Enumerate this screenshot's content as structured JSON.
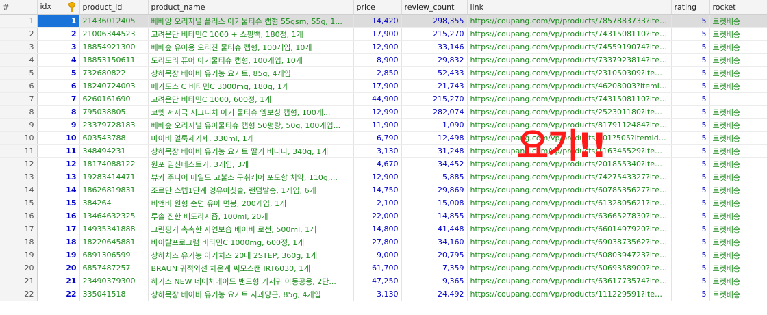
{
  "columns": [
    "#",
    "idx",
    "product_id",
    "product_name",
    "price",
    "review_count",
    "link",
    "rating",
    "rocket"
  ],
  "rows": [
    {
      "n": "1",
      "idx": "1",
      "pid": "21436012405",
      "name": "베베앙 오리지널 플러스 아기물티슈 캡형 55gsm, 55g, 1...",
      "price": "14,420",
      "reviews": "298,355",
      "link": "https://coupang.com/vp/products/7857883733?itemId=...",
      "rating": "5",
      "rocket": "로켓배송"
    },
    {
      "n": "2",
      "idx": "2",
      "pid": "21006344523",
      "name": "고려은단 비타민C 1000 + 쇼핑백, 180정, 1개",
      "price": "17,900",
      "reviews": "215,270",
      "link": "https://coupang.com/vp/products/7431508110?itemId=...",
      "rating": "5",
      "rocket": "로켓배송"
    },
    {
      "n": "3",
      "idx": "3",
      "pid": "18854921300",
      "name": "베베숲 유아용 오리진 물티슈 캡형, 100개입, 10개",
      "price": "12,900",
      "reviews": "33,146",
      "link": "https://coupang.com/vp/products/7455919074?itemId=...",
      "rating": "5",
      "rocket": "로켓배송"
    },
    {
      "n": "4",
      "idx": "4",
      "pid": "18853150611",
      "name": "도리도리 퓨어 아기물티슈 캡형, 100개입, 10개",
      "price": "8,900",
      "reviews": "29,832",
      "link": "https://coupang.com/vp/products/7337923814?itemId=...",
      "rating": "5",
      "rocket": "로켓배송"
    },
    {
      "n": "5",
      "idx": "5",
      "pid": "732680822",
      "name": "상하목장 베이비 유기농 요거트, 85g, 4개입",
      "price": "2,850",
      "reviews": "52,433",
      "link": "https://coupang.com/vp/products/231050309?itemId=7...",
      "rating": "5",
      "rocket": "로켓배송"
    },
    {
      "n": "6",
      "idx": "6",
      "pid": "18240724003",
      "name": "메가도스 C 비타민C 3000mg, 180g, 1개",
      "price": "17,900",
      "reviews": "21,743",
      "link": "https://coupang.com/vp/products/46208003?itemId=18...",
      "rating": "5",
      "rocket": "로켓배송"
    },
    {
      "n": "7",
      "idx": "7",
      "pid": "6260161690",
      "name": "고려은단 비타민C 1000, 600정, 1개",
      "price": "44,900",
      "reviews": "215,270",
      "link": "https://coupang.com/vp/products/7431508110?itemId=...",
      "rating": "5",
      "rocket": ""
    },
    {
      "n": "8",
      "idx": "8",
      "pid": "795038805",
      "name": "코멧 저자극 시그니처 아기 물티슈 엠보싱 캡형, 100개...",
      "price": "12,990",
      "reviews": "282,074",
      "link": "https://coupang.com/vp/products/252301180?itemId=7...",
      "rating": "5",
      "rocket": "로켓배송"
    },
    {
      "n": "9",
      "idx": "9",
      "pid": "23379728183",
      "name": "베베숲 오리지널 유아물티슈 캡형 50평량, 50g, 100개입...",
      "price": "11,900",
      "reviews": "1,090",
      "link": "https://coupang.com/vp/products/8179112484?itemId=...",
      "rating": "5",
      "rocket": "로켓배송"
    },
    {
      "n": "10",
      "idx": "10",
      "pid": "603543788",
      "name": "마이비 얼룩제거제, 330ml, 1개",
      "price": "6,790",
      "reviews": "12,498",
      "link": "https://coupang.com/vp/products/201?505?itemId=6...",
      "rating": "5",
      "rocket": "로켓배송"
    },
    {
      "n": "11",
      "idx": "11",
      "pid": "348494231",
      "name": "상하목장 베이비 유기농 요거트 딸기 바나나, 340g, 1개",
      "price": "3,130",
      "reviews": "31,248",
      "link": "https://coupang.com/vp/products/116345529?itemId=3...",
      "rating": "5",
      "rocket": "로켓배송"
    },
    {
      "n": "12",
      "idx": "12",
      "pid": "18174088122",
      "name": "원포 임신테스트기, 3개입, 3개",
      "price": "4,670",
      "reviews": "34,452",
      "link": "https://coupang.com/vp/products/201855340?itemId=1...",
      "rating": "5",
      "rocket": "로켓배송"
    },
    {
      "n": "13",
      "idx": "13",
      "pid": "19283414471",
      "name": "뷰카 주니어 마일드 고불소 구취케어 포도향 치약, 110g,...",
      "price": "12,900",
      "reviews": "5,885",
      "link": "https://coupang.com/vp/products/7427543327?itemId=...",
      "rating": "5",
      "rocket": "로켓배송"
    },
    {
      "n": "14",
      "idx": "14",
      "pid": "18626819831",
      "name": "조르단 스텝1단계 영유아칫솔, 랜덤발송, 1개입, 6개",
      "price": "14,750",
      "reviews": "29,869",
      "link": "https://coupang.com/vp/products/6078535627?itemId=...",
      "rating": "5",
      "rocket": "로켓배송"
    },
    {
      "n": "15",
      "idx": "15",
      "pid": "384264",
      "name": "비앤비 원형 순면 유아 면봉, 200개입, 1개",
      "price": "2,100",
      "reviews": "15,008",
      "link": "https://coupang.com/vp/products/6132805621?itemId=...",
      "rating": "5",
      "rocket": "로켓배송"
    },
    {
      "n": "16",
      "idx": "16",
      "pid": "13464632325",
      "name": "루솔 진한 배도라지즙, 100ml, 20개",
      "price": "22,000",
      "reviews": "14,855",
      "link": "https://coupang.com/vp/products/6366527830?itemId=...",
      "rating": "5",
      "rocket": "로켓배송"
    },
    {
      "n": "17",
      "idx": "17",
      "pid": "14935341888",
      "name": "그린핑거 촉촉한 자연보습 베이비 로션, 500ml, 1개",
      "price": "14,800",
      "reviews": "41,448",
      "link": "https://coupang.com/vp/products/6601497920?itemId=...",
      "rating": "5",
      "rocket": "로켓배송"
    },
    {
      "n": "18",
      "idx": "18",
      "pid": "18220645881",
      "name": "바이탈프로그램 비타민C 1000mg, 600정, 1개",
      "price": "27,800",
      "reviews": "34,160",
      "link": "https://coupang.com/vp/products/6903873562?itemId=...",
      "rating": "5",
      "rocket": "로켓배송"
    },
    {
      "n": "19",
      "idx": "19",
      "pid": "6891306599",
      "name": "상하치즈 유기농 아기치즈 20매 2STEP, 360g, 1개",
      "price": "9,000",
      "reviews": "20,795",
      "link": "https://coupang.com/vp/products/5080394723?itemId=...",
      "rating": "5",
      "rocket": "로켓배송"
    },
    {
      "n": "20",
      "idx": "20",
      "pid": "6857487257",
      "name": "BRAUN 귀적외선 체온계 써모스캔 IRT6030, 1개",
      "price": "61,700",
      "reviews": "7,359",
      "link": "https://coupang.com/vp/products/5069358900?itemId=...",
      "rating": "5",
      "rocket": "로켓배송"
    },
    {
      "n": "21",
      "idx": "21",
      "pid": "23490379300",
      "name": "하기스 NEW 네이처메이드 밴드형 기저귀 아동공용, 2단...",
      "price": "47,250",
      "reviews": "9,365",
      "link": "https://coupang.com/vp/products/6361773574?itemId=...",
      "rating": "5",
      "rocket": "로켓배송"
    },
    {
      "n": "22",
      "idx": "22",
      "pid": "335041518",
      "name": "상하목장 베이비 유기농 요거트 사과당근, 85g, 4개입",
      "price": "3,130",
      "reviews": "24,492",
      "link": "https://coupang.com/vp/products/111229591?itemId=5...",
      "rating": "5",
      "rocket": "로켓배송"
    }
  ],
  "overlay_text": "요기!!",
  "icons": {
    "idx_header": "key-icon"
  },
  "colors": {
    "selected": "#1a73d9",
    "overlay": "#ff1a1a",
    "text_green": "#1a8a1a",
    "text_blue": "#0000cc"
  }
}
